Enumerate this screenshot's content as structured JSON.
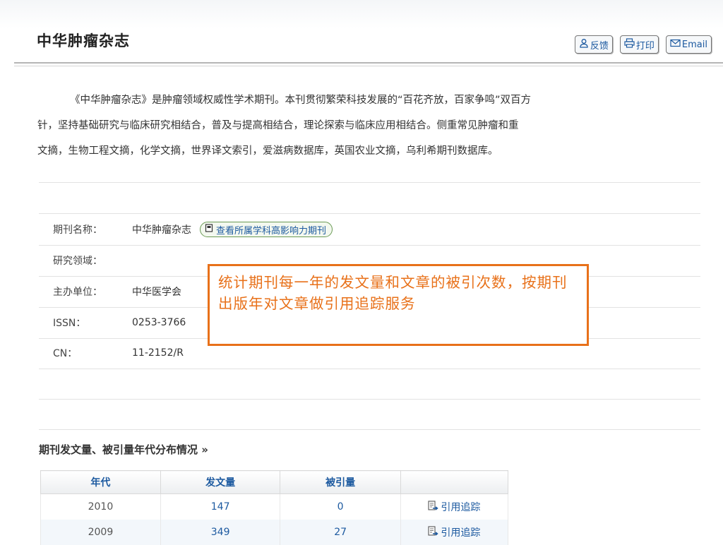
{
  "journal": {
    "title": "中华肿瘤杂志"
  },
  "toolbar": {
    "feedback": "反馈",
    "print": "打印",
    "email": "Email"
  },
  "intro": {
    "lines": [
      "《中华肿瘤杂志》是肿瘤领域权威性学术期刊。本刊贯彻繁荣科技发展的“百花齐放，百家争鸣”双百方",
      "针，坚持基础研究与临床研究相结合，普及与提高相结合，理论探索与临床应用相结合。侧重常见肿瘤和重",
      "文摘，生物工程文摘，化学文摘，世界译文索引，爱滋病数据库，英国农业文摘，乌利希期刊数据库。"
    ]
  },
  "info": {
    "rows": [
      {
        "label": "期刊名称：",
        "value": "中华肿瘤杂志"
      },
      {
        "label": "研究领域：",
        "value": ""
      },
      {
        "label": "主办单位：",
        "value": "中华医学会"
      },
      {
        "label": "ISSN：",
        "value": "0253-3766"
      },
      {
        "label": "CN：",
        "value": "11-2152/R"
      }
    ],
    "subject_link": "查看所属学科高影响力期刊"
  },
  "callout": {
    "text": "统计期刊每一年的发文量和文章的被引次数，按期刊出版年对文章做引用追踪服务"
  },
  "stats": {
    "title": "期刊发文量、被引量年代分布情况 »",
    "headers": [
      "年代",
      "发文量",
      "被引量",
      ""
    ],
    "rows": [
      {
        "year": "2010",
        "articles": "147",
        "citations": "0",
        "action": "引用追踪"
      },
      {
        "year": "2009",
        "articles": "349",
        "citations": "27",
        "action": "引用追踪"
      }
    ]
  },
  "colors": {
    "accent": "#1d5aa0",
    "callout": "#e8711a"
  }
}
